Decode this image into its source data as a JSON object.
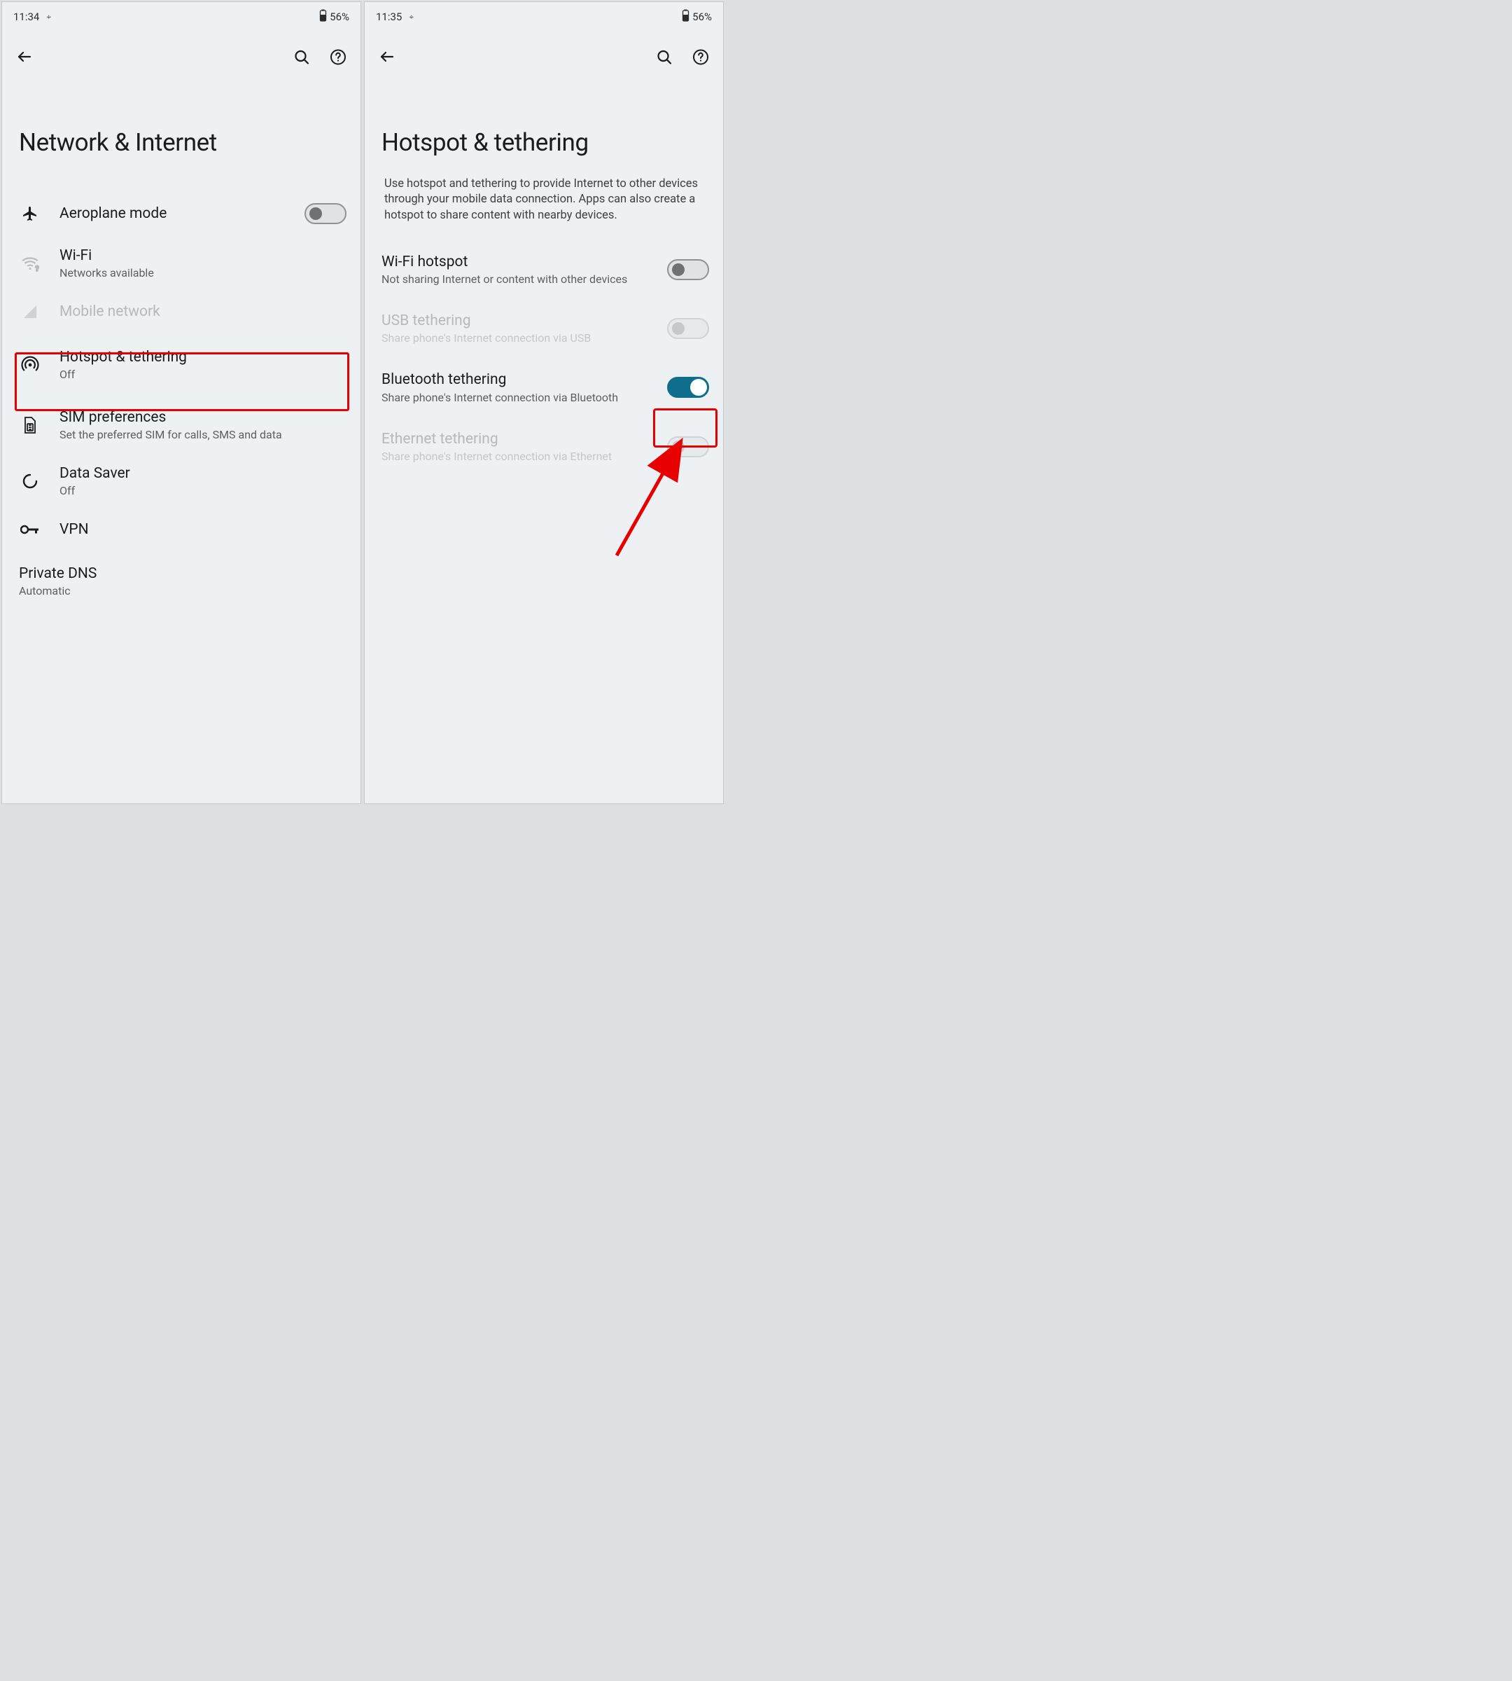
{
  "left": {
    "status": {
      "time": "11:34",
      "battery": "56%"
    },
    "title": "Network & Internet",
    "items": {
      "airplane": {
        "label": "Aeroplane mode"
      },
      "wifi": {
        "label": "Wi-Fi",
        "sub": "Networks available"
      },
      "mobile": {
        "label": "Mobile network"
      },
      "hotspot": {
        "label": "Hotspot & tethering",
        "sub": "Off"
      },
      "sim": {
        "label": "SIM preferences",
        "sub": "Set the preferred SIM for calls, SMS and data"
      },
      "datasaver": {
        "label": "Data Saver",
        "sub": "Off"
      },
      "vpn": {
        "label": "VPN"
      },
      "dns": {
        "label": "Private DNS",
        "sub": "Automatic"
      }
    }
  },
  "right": {
    "status": {
      "time": "11:35",
      "battery": "56%"
    },
    "title": "Hotspot & tethering",
    "description": "Use hotspot and tethering to provide Internet to other devices through your mobile data connection. Apps can also create a hotspot to share content with nearby devices.",
    "items": {
      "wifi_hotspot": {
        "label": "Wi-Fi hotspot",
        "sub": "Not sharing Internet or content with other devices"
      },
      "usb": {
        "label": "USB tethering",
        "sub": "Share phone's Internet connection via USB"
      },
      "bluetooth": {
        "label": "Bluetooth tethering",
        "sub": "Share phone's Internet connection via Bluetooth"
      },
      "ethernet": {
        "label": "Ethernet tethering",
        "sub": "Share phone's Internet connection via Ethernet"
      }
    }
  }
}
